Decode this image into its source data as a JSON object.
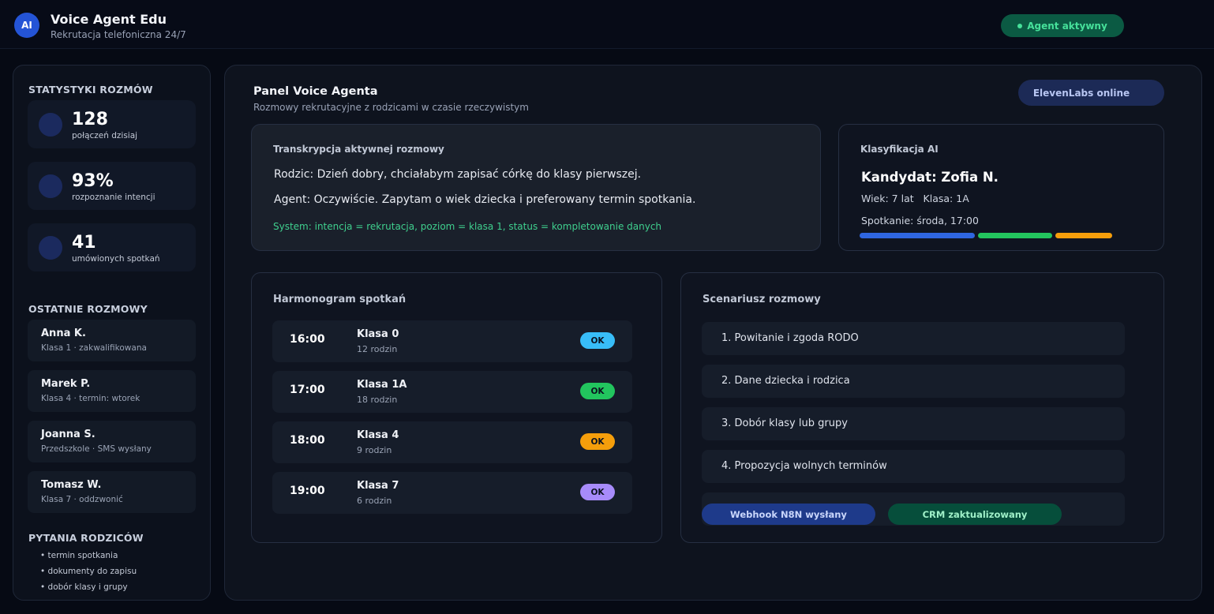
{
  "header": {
    "logo_text": "AI",
    "app_title": "Voice Agent Edu",
    "app_subtitle": "Rekrutacja telefoniczna 24/7",
    "agent_status": "Agent aktywny",
    "agent_status_color": "#46e09a"
  },
  "sidebar": {
    "stats_heading": "STATYSTYKI ROZMÓW",
    "stats": [
      {
        "value": "128",
        "label": "połączeń dzisiaj"
      },
      {
        "value": "93%",
        "label": "rozpoznanie intencji"
      },
      {
        "value": "41",
        "label": "umówionych spotkań"
      }
    ],
    "recent_heading": "OSTATNIE ROZMOWY",
    "recent": [
      {
        "name": "Anna K.",
        "detail": "Klasa 1 · zakwalifikowana"
      },
      {
        "name": "Marek P.",
        "detail": "Klasa 4 · termin: wtorek"
      },
      {
        "name": "Joanna S.",
        "detail": "Przedszkole · SMS wysłany"
      },
      {
        "name": "Tomasz W.",
        "detail": "Klasa 7 · oddzwonić"
      }
    ],
    "questions_heading": "PYTANIA RODZICÓW",
    "questions": [
      "• termin spotkania",
      "• dokumenty do zapisu",
      "• dobór klasy i grupy"
    ]
  },
  "main": {
    "title": "Panel Voice Agenta",
    "subtitle": "Rozmowy rekrutacyjne z rodzicami w czasie rzeczywistym",
    "integration_status": "ElevenLabs online",
    "transcript": {
      "heading": "Transkrypcja aktywnej rozmowy",
      "lines": [
        "Rodzic: Dzień dobry, chciałabym zapisać córkę do klasy pierwszej.",
        "Agent: Oczywiście. Zapytam o wiek dziecka i preferowany termin spotkania."
      ],
      "system": "System: intencja = rekrutacja, poziom = klasa 1, status = kompletowanie danych"
    },
    "classification": {
      "heading": "Klasyfikacja AI",
      "candidate": "Kandydat: Zofia N.",
      "age_class": "Wiek: 7 lat   Klasa: 1A",
      "meeting": "Spotkanie: środa, 17:00",
      "bar_colors": [
        "#2f66e0",
        "#23c55e",
        "#f59e0b"
      ]
    },
    "schedule": {
      "heading": "Harmonogram spotkań",
      "rows": [
        {
          "time": "16:00",
          "class": "Klasa 0",
          "parents": "12 rodzin",
          "status": "OK",
          "color": "#38bdf8"
        },
        {
          "time": "17:00",
          "class": "Klasa 1A",
          "parents": "18 rodzin",
          "status": "OK",
          "color": "#22c55e"
        },
        {
          "time": "18:00",
          "class": "Klasa 4",
          "parents": "9 rodzin",
          "status": "OK",
          "color": "#f59e0b"
        },
        {
          "time": "19:00",
          "class": "Klasa 7",
          "parents": "6 rodzin",
          "status": "OK",
          "color": "#a78bfa"
        }
      ]
    },
    "script": {
      "heading": "Scenariusz rozmowy",
      "steps": [
        "1. Powitanie i zgoda RODO",
        "2. Dane dziecka i rodzica",
        "3. Dobór klasy lub grupy",
        "4. Propozycja wolnych terminów"
      ],
      "tags": [
        "Webhook N8N wysłany",
        "CRM zaktualizowany"
      ]
    }
  }
}
